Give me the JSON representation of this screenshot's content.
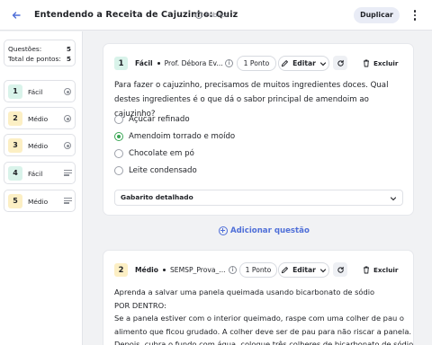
{
  "header": {
    "title": "Entendendo a Receita de Cajuzinho: Quiz",
    "visibility": "Público",
    "duplicate_label": "Duplicar"
  },
  "sidebar": {
    "stats": [
      {
        "label": "Questões:",
        "value": "5"
      },
      {
        "label": "Total de pontos:",
        "value": "5"
      }
    ],
    "items": [
      {
        "number": "1",
        "difficulty": "Fácil",
        "type_icon": "radio-icon",
        "color": "#d9f3ea"
      },
      {
        "number": "2",
        "difficulty": "Médio",
        "type_icon": "radio-icon",
        "color": "#fcefc4"
      },
      {
        "number": "3",
        "difficulty": "Médio",
        "type_icon": "radio-icon",
        "color": "#fcefc4"
      },
      {
        "number": "4",
        "difficulty": "Fácil",
        "type_icon": "lines-icon",
        "color": "#d9f3ea"
      },
      {
        "number": "5",
        "difficulty": "Médio",
        "type_icon": "lines-icon",
        "color": "#fcefc4"
      }
    ]
  },
  "questions": [
    {
      "number": "1",
      "badge_color": "#d9f3ea",
      "difficulty": "Fácil",
      "author": "Prof. Débora Ev...",
      "points": "1 Ponto",
      "edit_label": "Editar",
      "delete_label": "Excluir",
      "text": "Para fazer o cajuzinho, precisamos de muitos ingredientes doces. Qual destes ingredientes é o que dá o sabor principal de amendoim ao cajuzinho?",
      "options": [
        {
          "label": "Açúcar refinado",
          "selected": false
        },
        {
          "label": "Amendoim torrado e moído",
          "selected": true
        },
        {
          "label": "Chocolate em pó",
          "selected": false
        },
        {
          "label": "Leite condensado",
          "selected": false
        }
      ],
      "answer_key_label": "Gabarito detalhado"
    },
    {
      "number": "2",
      "badge_color": "#fcefc4",
      "difficulty": "Médio",
      "author": "SEMSP_Prova_...",
      "points": "1 Ponto",
      "edit_label": "Editar",
      "delete_label": "Excluir",
      "lines": [
        "Aprenda a salvar uma panela queimada usando bicarbonato de sódio",
        "POR DENTRO:",
        "Se a panela estiver com o interior queimado, raspe com uma colher de pau o",
        "alimento que ficou grudado. A colher deve ser de pau para não riscar a panela.",
        "Depois, cubra o fundo com água, coloque três colheres de bicarbonato de sódio"
      ]
    }
  ],
  "add_question_label": "Adicionar questão",
  "colors": {
    "accent": "#4f6fd8",
    "selected": "#3aa655"
  }
}
